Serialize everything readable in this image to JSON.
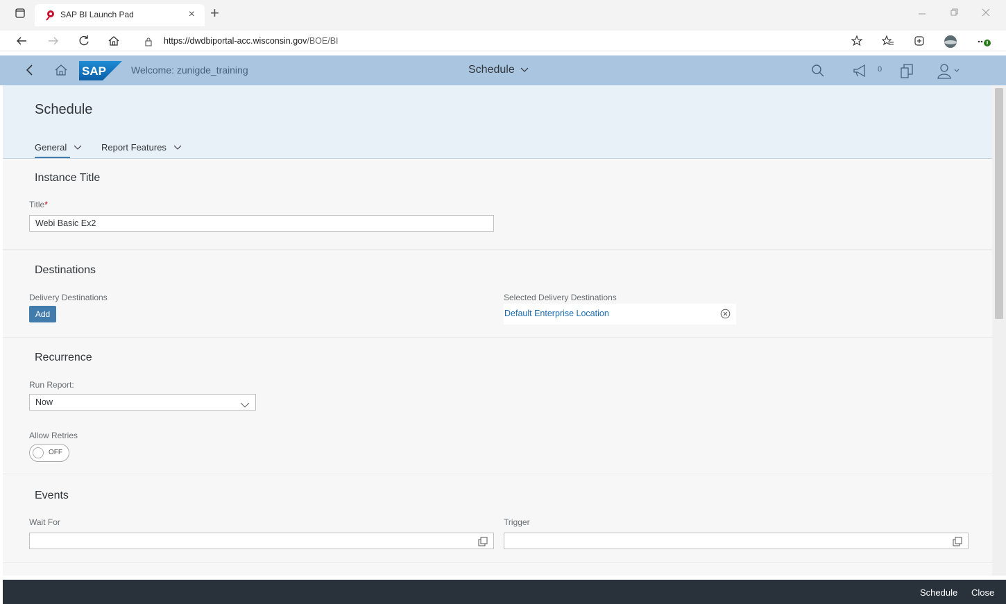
{
  "browser": {
    "tab_title": "SAP BI Launch Pad",
    "url_host": "https://dwdbiportal-acc.wisconsin.gov",
    "url_path": "/BOE/BI",
    "tab_close": "×",
    "new_tab": "+"
  },
  "shell": {
    "welcome": "Welcome: zunigde_training",
    "title": "Schedule",
    "notification_count": "0",
    "logo_text": "SAP"
  },
  "page": {
    "title": "Schedule",
    "tabs": [
      {
        "label": "General"
      },
      {
        "label": "Report Features"
      }
    ]
  },
  "instance": {
    "section_title": "Instance Title",
    "title_label": "Title",
    "required_mark": "*",
    "title_value": "Webi Basic Ex2"
  },
  "destinations": {
    "section_title": "Destinations",
    "delivery_label": "Delivery Destinations",
    "add_label": "Add",
    "selected_label": "Selected Delivery Destinations",
    "selected_items": [
      "Default Enterprise Location"
    ]
  },
  "recurrence": {
    "section_title": "Recurrence",
    "run_report_label": "Run Report:",
    "run_report_value": "Now",
    "allow_retries_label": "Allow Retries",
    "allow_retries_state": "OFF"
  },
  "events": {
    "section_title": "Events",
    "wait_for_label": "Wait For",
    "wait_for_value": "",
    "trigger_label": "Trigger",
    "trigger_value": ""
  },
  "footer": {
    "schedule_label": "Schedule",
    "close_label": "Close"
  },
  "colors": {
    "shell": "#a9c5e0",
    "accent": "#427cac",
    "link": "#1a6bb0",
    "footer": "#29313a"
  }
}
